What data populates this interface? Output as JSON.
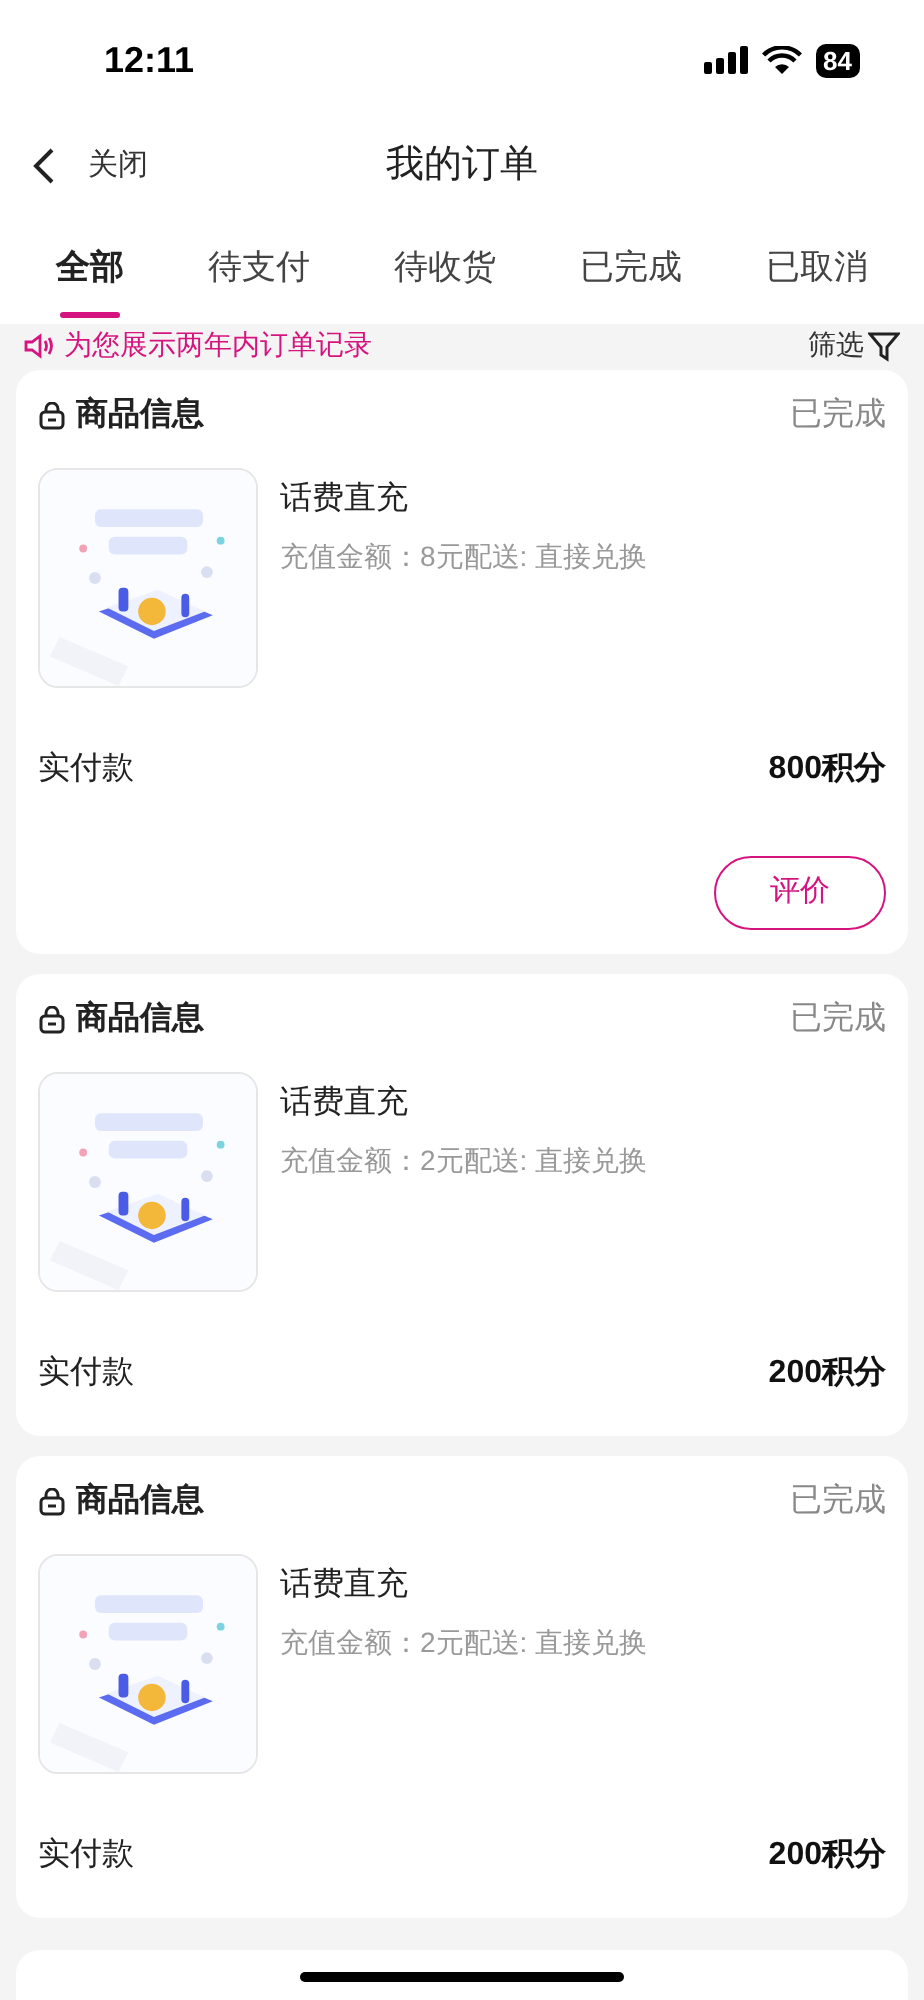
{
  "status_bar": {
    "time": "12:11",
    "battery": "84"
  },
  "nav": {
    "back_label": "关闭",
    "title": "我的订单"
  },
  "tabs": [
    {
      "label": "全部",
      "selected": true
    },
    {
      "label": "待支付",
      "selected": false
    },
    {
      "label": "待收货",
      "selected": false
    },
    {
      "label": "已完成",
      "selected": false
    },
    {
      "label": "已取消",
      "selected": false
    }
  ],
  "notice": {
    "text": "为您展示两年内订单记录",
    "filter": "筛选"
  },
  "orders": [
    {
      "section": "商品信息",
      "status": "已完成",
      "product": "话费直充",
      "detail": "充值金额：8元配送: 直接兑换",
      "paid_label": "实付款",
      "paid": "800积分",
      "actions": [
        "评价"
      ]
    },
    {
      "section": "商品信息",
      "status": "已完成",
      "product": "话费直充",
      "detail": "充值金额：2元配送: 直接兑换",
      "paid_label": "实付款",
      "paid": "200积分"
    },
    {
      "section": "商品信息",
      "status": "已完成",
      "product": "话费直充",
      "detail": "充值金额：2元配送: 直接兑换",
      "paid_label": "实付款",
      "paid": "200积分"
    }
  ]
}
